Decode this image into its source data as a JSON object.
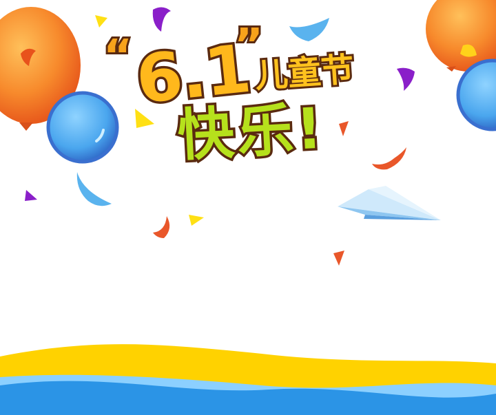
{
  "headline": {
    "quote_open": "“",
    "number": "6.1",
    "quote_close": "”",
    "festival": "儿童节",
    "joy": "快乐!"
  },
  "palette": {
    "orange_balloon": "#f7882c",
    "blue_balloon": "#4b9be8",
    "wave_yellow": "#ffd200",
    "wave_blue": "#2b94e6",
    "confetti_purple": "#8a1fc9",
    "confetti_red": "#e9572a",
    "confetti_yellow": "#ffe014",
    "confetti_lightblue": "#5ab3ee"
  },
  "icons": [
    "balloon-icon",
    "paper-plane-icon",
    "confetti-icon"
  ]
}
